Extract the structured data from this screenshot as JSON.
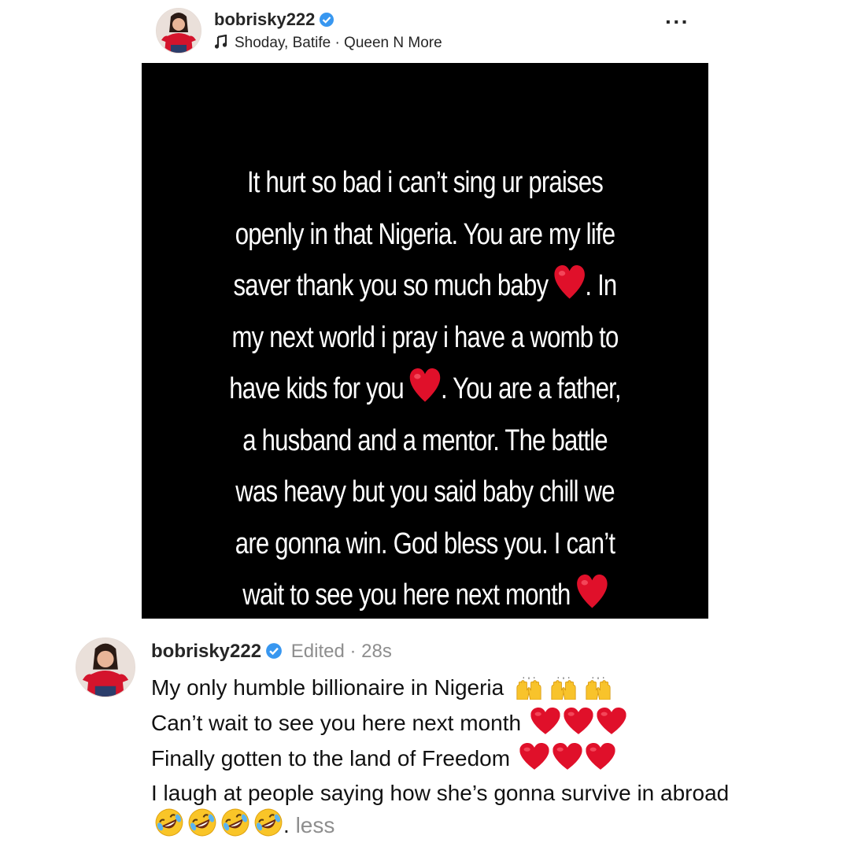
{
  "post": {
    "username": "bobrisky222",
    "music": "Shoday, Batife · Queen N More",
    "more_label": "···",
    "image_text": {
      "line1": "It hurt so bad i can’t sing ur praises",
      "line2": "openly in that Nigeria. You are my life",
      "line3a": "saver thank you so much baby ",
      "line3b": ". In",
      "line4": "my next world i pray i have a womb to",
      "line5a": "have kids for you ",
      "line5b": ". You are a father,",
      "line6": "a husband and a mentor. The battle",
      "line7": "was heavy but you said baby chill we",
      "line8": "are gonna win. God bless you. I can’t",
      "line9": "wait to see you here next month "
    }
  },
  "caption": {
    "username": "bobrisky222",
    "meta": "Edited · 28s",
    "line1": "My only humble billionaire in Nigeria",
    "line2": "Can’t wait to see you here next month",
    "line3": "Finally gotten to the land of Freedom",
    "line4": "I laugh at people saying how she’s gonna survive in abroad",
    "less_label": "less"
  },
  "icons": {
    "verified": "verified-badge-icon",
    "music": "music-note-icon",
    "heart": "red-heart-emoji",
    "raised_hands": "raised-hands-emoji",
    "laughing": "rolling-on-floor-laughing-emoji"
  },
  "colors": {
    "verified_blue": "#3897f0",
    "heart_red": "#e0102a",
    "meta_gray": "#8e8e8e",
    "image_bg": "#000000"
  }
}
